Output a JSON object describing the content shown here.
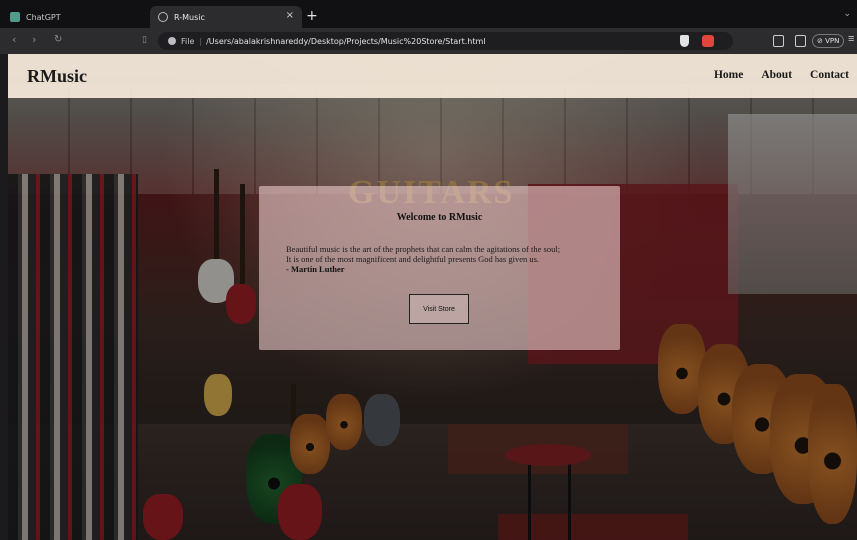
{
  "browser": {
    "tabs": [
      {
        "label": "ChatGPT",
        "active": false,
        "icon": "chatgpt-icon"
      },
      {
        "label": "R-Music",
        "active": true,
        "icon": "globe-icon"
      }
    ],
    "new_tab_symbol": "+",
    "close_symbol": "×",
    "url_scheme_label": "File",
    "url": "/Users/abalakrishnareddy/Desktop/Projects/Music%20Store/Start.html",
    "vpn_label": "⊘ VPN"
  },
  "site": {
    "logo": "RMusic",
    "nav": {
      "home": "Home",
      "about": "About",
      "contact": "Contact"
    },
    "background_sign": "GUITARS"
  },
  "welcome": {
    "title": "Welcome to RMusic",
    "quote_line1": "Beautiful music is the art of the prophets that can calm the agitations of the soul;",
    "quote_line2": "It is one of the most magnificent and delightful presents God has given us.",
    "author": "- Martin Luther",
    "button_label": "Visit Store"
  },
  "colors": {
    "header_bg": "#f5e9da",
    "card_bg": "#e8c8c8",
    "chrome_dark": "#111113",
    "toolbar": "#2c2c2f"
  }
}
